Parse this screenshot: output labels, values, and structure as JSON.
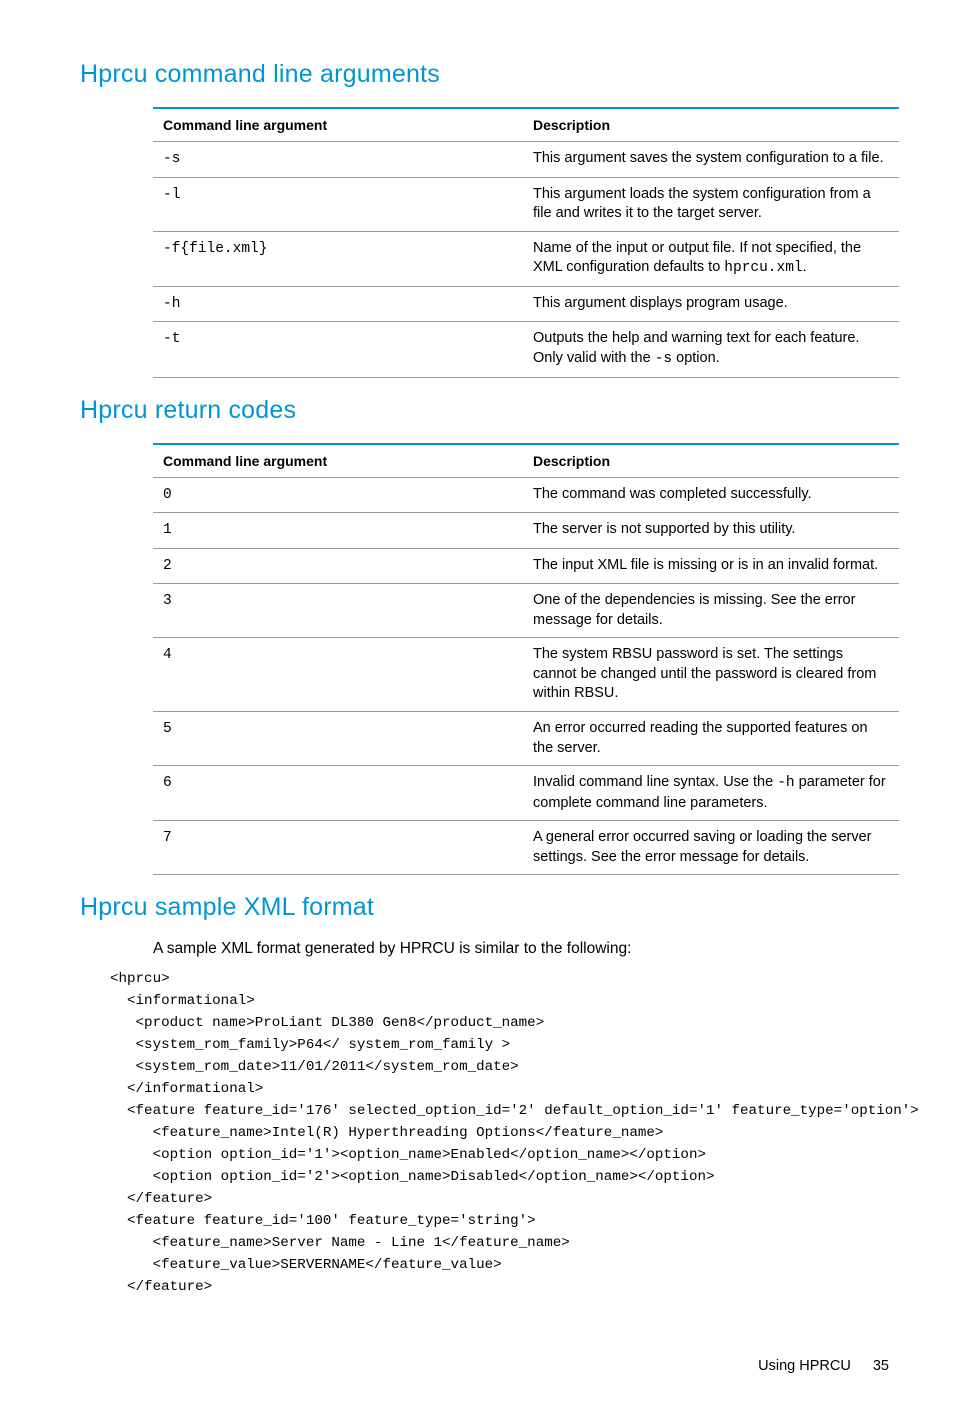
{
  "sections": {
    "args": {
      "heading": "Hprcu command line arguments",
      "header_arg": "Command line argument",
      "header_desc": "Description",
      "rows": [
        {
          "arg_mono": "-s",
          "desc_pre": "This argument saves the system configuration to a file."
        },
        {
          "arg_mono": "-l",
          "desc_pre": "This argument loads the system configuration from a file and writes it to the target server."
        },
        {
          "arg_mono": "-f{file.xml}",
          "desc_pre": "Name of the input or output file. If not specified, the XML configuration defaults to ",
          "desc_code": "hprcu.xml",
          "desc_post": "."
        },
        {
          "arg_mono": "-h",
          "desc_pre": "This argument displays program usage."
        },
        {
          "arg_mono": "-t",
          "desc_pre": "Outputs the help and warning text for each feature. Only valid with the ",
          "desc_code": "-s",
          "desc_post": " option."
        }
      ]
    },
    "codes": {
      "heading": "Hprcu return codes",
      "header_arg": "Command line argument",
      "header_desc": "Description",
      "rows": [
        {
          "arg_mono": "0",
          "desc_pre": "The command was completed successfully."
        },
        {
          "arg_mono": "1",
          "desc_pre": "The server is not supported by this utility."
        },
        {
          "arg_mono": "2",
          "desc_pre": "The input XML file is missing or is in an invalid format."
        },
        {
          "arg_mono": "3",
          "desc_pre": "One of the dependencies is missing. See the error message for details."
        },
        {
          "arg_mono": "4",
          "desc_pre": "The system RBSU password is set. The settings cannot be changed until the password is cleared from within RBSU."
        },
        {
          "arg_mono": "5",
          "desc_pre": "An error occurred reading the supported features on the server."
        },
        {
          "arg_mono": "6",
          "desc_pre": "Invalid command line syntax. Use the ",
          "desc_code": "-h",
          "desc_post": " parameter for complete command line parameters."
        },
        {
          "arg_mono": "7",
          "desc_pre": "A general error occurred saving or loading the server settings. See the error message for details."
        }
      ]
    },
    "xml": {
      "heading": "Hprcu sample XML format",
      "intro": "A sample XML format generated by HPRCU is similar to the following:",
      "code": "<hprcu>\n  <informational>\n   <product name>ProLiant DL380 Gen8</product_name>\n   <system_rom_family>P64</ system_rom_family >\n   <system_rom_date>11/01/2011</system_rom_date>\n  </informational>\n  <feature feature_id='176' selected_option_id='2' default_option_id='1' feature_type='option'>\n     <feature_name>Intel(R) Hyperthreading Options</feature_name>\n     <option option_id='1'><option_name>Enabled</option_name></option>\n     <option option_id='2'><option_name>Disabled</option_name></option>\n  </feature>\n  <feature feature_id='100' feature_type='string'>\n     <feature_name>Server Name - Line 1</feature_name>\n     <feature_value>SERVERNAME</feature_value>\n  </feature>"
    }
  },
  "footer": {
    "label": "Using HPRCU",
    "page": "35"
  }
}
